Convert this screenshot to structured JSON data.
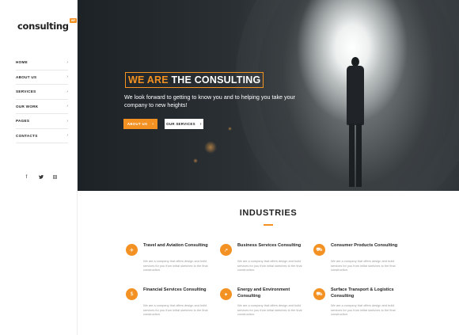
{
  "brand": {
    "name": "consulting",
    "badge": "WP"
  },
  "nav": {
    "items": [
      {
        "label": "HOME",
        "chevron": "›"
      },
      {
        "label": "ABOUT US",
        "chevron": "›"
      },
      {
        "label": "SERVICES",
        "chevron": "›"
      },
      {
        "label": "OUR WORK",
        "chevron": "›"
      },
      {
        "label": "PAGES",
        "chevron": "›"
      },
      {
        "label": "CONTACTS",
        "chevron": "›"
      }
    ]
  },
  "social": {
    "facebook": "f",
    "twitter": "🐦",
    "instagram": "◘"
  },
  "hero": {
    "title_accent": "WE ARE",
    "title_rest": "THE CONSULTING",
    "subtitle": "We look forward to getting to know you and to helping you take your company to new heights!",
    "buttons": {
      "primary": "ABOUT US",
      "secondary": "OUR SERVICES",
      "chevron": "›"
    }
  },
  "industries": {
    "title": "INDUSTRIES",
    "cards": [
      {
        "title": "Travel and Aviation Consulting",
        "text": "We are a company that offers design and build services for you from initial sketches to the final construction.",
        "icon": "plane-icon",
        "glyph": "✈"
      },
      {
        "title": "Business Services Consulting",
        "text": "We are a company that offers design and build services for you from initial sketches to the final construction.",
        "icon": "chart-icon",
        "glyph": "↗"
      },
      {
        "title": "Consumer Products Consulting",
        "text": "We are a company that offers design and build services for you from initial sketches to the final construction.",
        "icon": "cart-icon",
        "glyph": "⛟"
      },
      {
        "title": "Financial Services Consulting",
        "text": "We are a company that offers design and build services for you from initial sketches to the final construction.",
        "icon": "coins-icon",
        "glyph": "$"
      },
      {
        "title": "Energy and Environment Consulting",
        "text": "We are a company that offers design and build services for you from initial sketches to the final construction.",
        "icon": "bulb-icon",
        "glyph": "✦"
      },
      {
        "title": "Surface Transport & Logistics Consulting",
        "text": "We are a company that offers design and build services for you from initial sketches to the final construction.",
        "icon": "truck-icon",
        "glyph": "⛟"
      }
    ]
  },
  "colors": {
    "accent": "#f39122",
    "dark": "#222222",
    "muted": "#999999"
  }
}
